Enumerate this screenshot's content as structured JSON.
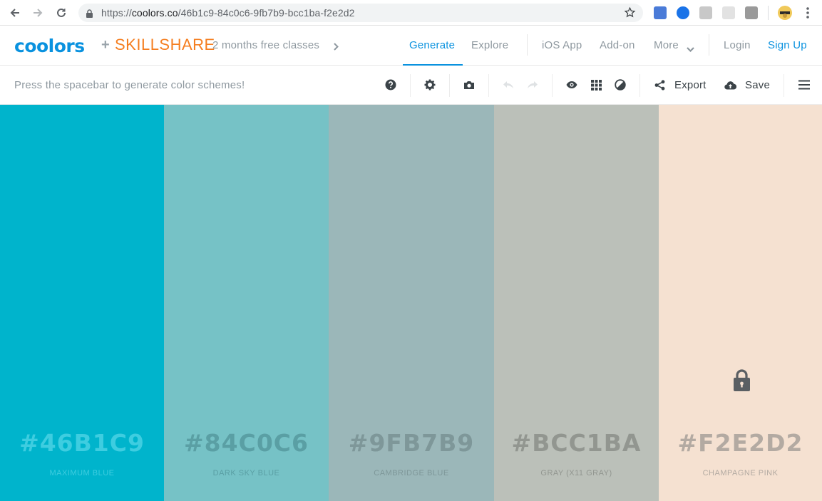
{
  "browser": {
    "url_prefix": "https://",
    "url_host": "coolors.co",
    "url_path": "/46b1c9-84c0c6-9fb7b9-bcc1ba-f2e2d2"
  },
  "header": {
    "logo": "coolors",
    "plus": "+",
    "partner": "SKILLSHARE",
    "promo": "2 months free classes",
    "nav": {
      "generate": "Generate",
      "explore": "Explore",
      "ios": "iOS App",
      "addon": "Add-on",
      "more": "More",
      "login": "Login",
      "signup": "Sign Up"
    }
  },
  "toolbar": {
    "hint": "Press the spacebar to generate color schemes!",
    "export": "Export",
    "save": "Save"
  },
  "palette": [
    {
      "hex": "#46B1C9",
      "name": "MAXIMUM BLUE",
      "bg": "#00b4cc",
      "fg": "#3ecde0",
      "locked": false
    },
    {
      "hex": "#84C0C6",
      "name": "DARK SKY BLUE",
      "bg": "#76c2c6",
      "fg": "#5a9fa4",
      "locked": false
    },
    {
      "hex": "#9FB7B9",
      "name": "CAMBRIDGE BLUE",
      "bg": "#9bb7b9",
      "fg": "#7e9799",
      "locked": false
    },
    {
      "hex": "#BCC1BA",
      "name": "GRAY (X11 GRAY)",
      "bg": "#bbc0b9",
      "fg": "#929690",
      "locked": false
    },
    {
      "hex": "#F2E2D2",
      "name": "CHAMPAGNE PINK",
      "bg": "#f5e1d1",
      "fg": "#b3aaa2",
      "locked": true
    }
  ],
  "colors": {
    "accent": "#0a92df",
    "skillshare": "#f57e20",
    "muted_text": "#8e989f",
    "dark_icon": "#3b4348"
  }
}
